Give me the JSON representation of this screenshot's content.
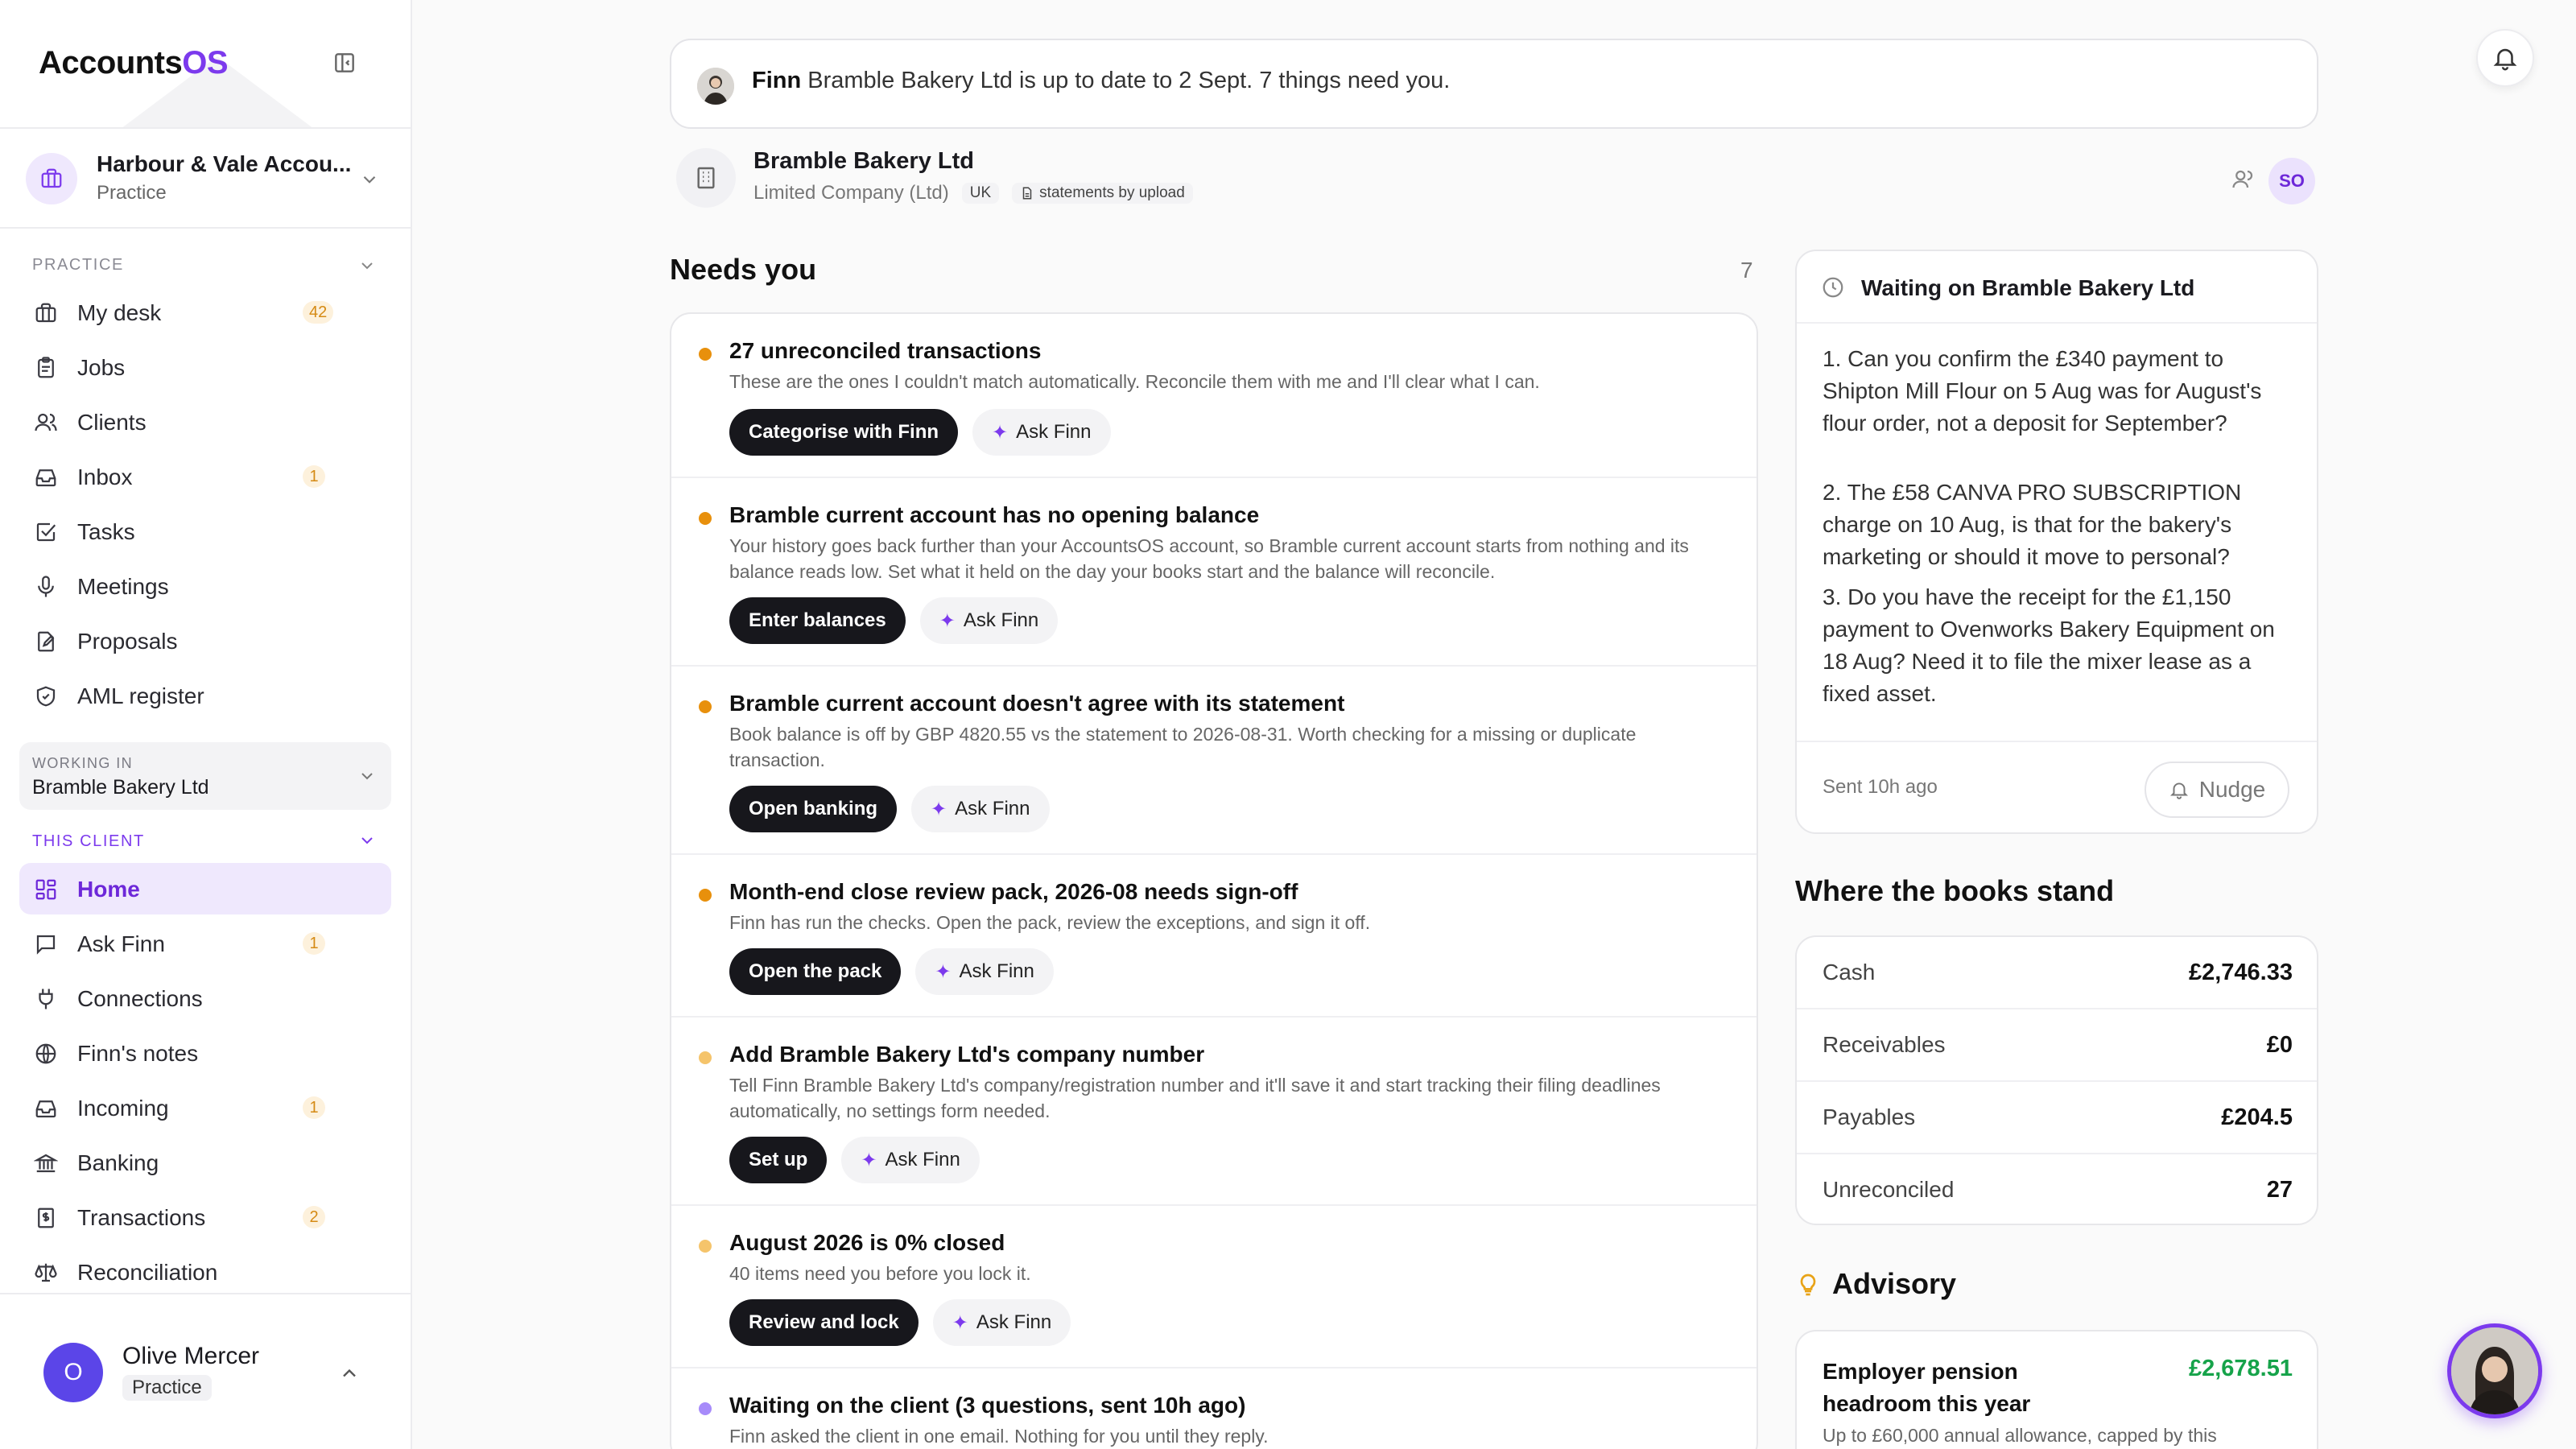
{
  "app": {
    "logo_main": "Accounts",
    "logo_accent": "OS"
  },
  "practice_switch": {
    "name": "Harbour & Vale Accou...",
    "type": "Practice"
  },
  "sidebar": {
    "practice_section": "PRACTICE",
    "practice_items": [
      {
        "label": "My desk",
        "badge": "42",
        "icon": "briefcase-icon"
      },
      {
        "label": "Jobs",
        "badge": "",
        "icon": "clipboard-icon"
      },
      {
        "label": "Clients",
        "badge": "",
        "icon": "users-icon"
      },
      {
        "label": "Inbox",
        "badge": "1",
        "icon": "inbox-icon"
      },
      {
        "label": "Tasks",
        "badge": "",
        "icon": "checkbox-icon"
      },
      {
        "label": "Meetings",
        "badge": "",
        "icon": "microphone-icon"
      },
      {
        "label": "Proposals",
        "badge": "",
        "icon": "document-edit-icon"
      },
      {
        "label": "AML register",
        "badge": "",
        "icon": "shield-icon"
      }
    ],
    "working_in_label": "WORKING IN",
    "working_in_client": "Bramble Bakery Ltd",
    "client_section": "THIS CLIENT",
    "client_items": [
      {
        "label": "Home",
        "badge": "",
        "icon": "grid-icon",
        "active": true
      },
      {
        "label": "Ask Finn",
        "badge": "1",
        "icon": "chat-icon"
      },
      {
        "label": "Connections",
        "badge": "",
        "icon": "plug-icon"
      },
      {
        "label": "Finn's notes",
        "badge": "",
        "icon": "globe-icon"
      },
      {
        "label": "Incoming",
        "badge": "1",
        "icon": "inbox-icon"
      },
      {
        "label": "Banking",
        "badge": "",
        "icon": "bank-icon"
      },
      {
        "label": "Transactions",
        "badge": "2",
        "icon": "receipt-icon"
      },
      {
        "label": "Reconciliation",
        "badge": "",
        "icon": "scales-icon"
      }
    ]
  },
  "user": {
    "initial": "O",
    "name": "Olive Mercer",
    "role": "Practice"
  },
  "banner": {
    "name": "Finn",
    "message": " Bramble Bakery Ltd is up to date to 2 Sept. 7 things need you."
  },
  "client": {
    "name": "Bramble Bakery Ltd",
    "type": "Limited Company (Ltd)",
    "country": "UK",
    "feed": "statements by upload",
    "assignee_initials": "SO"
  },
  "needs": {
    "title": "Needs you",
    "count": "7",
    "items": [
      {
        "title": "27 unreconciled transactions",
        "desc": "These are the ones I couldn't match automatically. Reconcile them with me and I'll clear what I can.",
        "primary": "Categorise with Finn",
        "secondary": "Ask Finn",
        "dot": "#e8900c"
      },
      {
        "title": "Bramble current account has no opening balance",
        "desc": "Your history goes back further than your AccountsOS account, so Bramble current account starts from nothing and its balance reads low. Set what it held on the day your books start and the balance will reconcile.",
        "primary": "Enter balances",
        "secondary": "Ask Finn",
        "dot": "#e8900c"
      },
      {
        "title": "Bramble current account doesn't agree with its statement",
        "desc": "Book balance is off by GBP 4820.55 vs the statement to 2026-08-31. Worth checking for a missing or duplicate transaction.",
        "primary": "Open banking",
        "secondary": "Ask Finn",
        "dot": "#e8900c"
      },
      {
        "title": "Month-end close review pack, 2026-08 needs sign-off",
        "desc": "Finn has run the checks. Open the pack, review the exceptions, and sign it off.",
        "primary": "Open the pack",
        "secondary": "Ask Finn",
        "dot": "#e8900c"
      },
      {
        "title": "Add Bramble Bakery Ltd's company number",
        "desc": "Tell Finn Bramble Bakery Ltd's company/registration number and it'll save it and start tracking their filing deadlines automatically, no settings form needed.",
        "primary": "Set up",
        "secondary": "Ask Finn",
        "dot": "#f5c46b"
      },
      {
        "title": "August 2026 is 0% closed",
        "desc": "40 items need you before you lock it.",
        "primary": "Review and lock",
        "secondary": "Ask Finn",
        "dot": "#f5c46b"
      },
      {
        "title": "Waiting on the client (3 questions, sent 10h ago)",
        "desc": "Finn asked the client in one email. Nothing for you until they reply.",
        "primary": "",
        "secondary": "",
        "dot": "#a78bfa"
      }
    ]
  },
  "waiting": {
    "title": "Waiting on Bramble Bakery Ltd",
    "questions": [
      "1. Can you confirm the £340 payment to Shipton Mill Flour on 5 Aug was for August's flour order, not a deposit for September?",
      "2. The £58 CANVA PRO SUBSCRIPTION charge on 10 Aug, is that for the bakery's marketing or should it move to personal?",
      "3. Do you have the receipt for the £1,150 payment to Ovenworks Bakery Equipment on 18 Aug? Need it to file the mixer lease as a fixed asset."
    ],
    "sent": "Sent 10h ago",
    "nudge": "Nudge"
  },
  "books": {
    "title": "Where the books stand",
    "rows": [
      {
        "label": "Cash",
        "value": "£2,746.33"
      },
      {
        "label": "Receivables",
        "value": "£0"
      },
      {
        "label": "Payables",
        "value": "£204.5"
      },
      {
        "label": "Unreconciled",
        "value": "27"
      }
    ]
  },
  "advisory": {
    "title": "Advisory",
    "card_title": "Employer pension headroom this year",
    "card_value": "£2,678.51",
    "card_desc": "Up to £60,000 annual allowance, capped by this"
  }
}
